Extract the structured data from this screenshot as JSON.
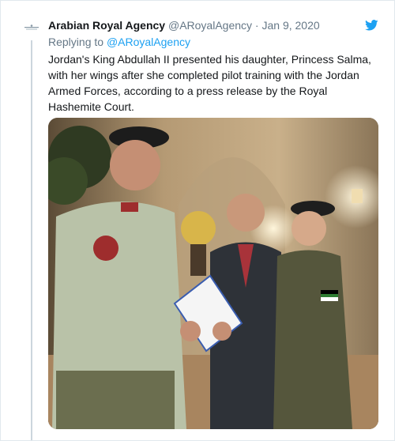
{
  "tweet": {
    "author_name": "Arabian Royal Agency",
    "author_handle": "@ARoyalAgency",
    "separator": "·",
    "date": "Jan 9, 2020",
    "replying_prefix": "Replying to",
    "replying_handle": "@ARoyalAgency",
    "text": "Jordan's King Abdullah II presented his daughter, Princess Salma, with her wings after she completed pilot training with the Jordan Armed Forces, according to a press release by the Royal Hashemite Court."
  },
  "icons": {
    "avatar": "agency-logo-icon",
    "brand": "twitter-bird-icon"
  },
  "colors": {
    "link": "#1da1f2",
    "text": "#14171a",
    "muted": "#657786",
    "border": "#e1e8ed"
  }
}
